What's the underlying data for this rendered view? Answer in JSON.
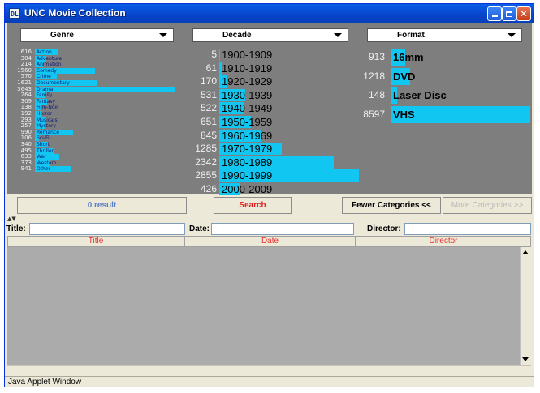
{
  "window": {
    "title": "UNC Movie Collection",
    "icon_text": "DL"
  },
  "genre": {
    "label": "Genre",
    "items": [
      {
        "count": "616",
        "label": "Action",
        "value": 616
      },
      {
        "count": "304",
        "label": "Adventure",
        "value": 304
      },
      {
        "count": "214",
        "label": "Animation",
        "value": 214
      },
      {
        "count": "1560",
        "label": "Comedy",
        "value": 1560
      },
      {
        "count": "570",
        "label": "Crime",
        "value": 570
      },
      {
        "count": "1621",
        "label": "Documentary",
        "value": 1621
      },
      {
        "count": "3643",
        "label": "Drama",
        "value": 3643
      },
      {
        "count": "264",
        "label": "Family",
        "value": 264
      },
      {
        "count": "309",
        "label": "Fantasy",
        "value": 309
      },
      {
        "count": "138",
        "label": "Film-Noir",
        "value": 138
      },
      {
        "count": "192",
        "label": "Horror",
        "value": 192
      },
      {
        "count": "293",
        "label": "Musicals",
        "value": 293
      },
      {
        "count": "257",
        "label": "Mystery",
        "value": 257
      },
      {
        "count": "990",
        "label": "Romance",
        "value": 990
      },
      {
        "count": "106",
        "label": "Sci-Fi",
        "value": 106
      },
      {
        "count": "340",
        "label": "Short",
        "value": 340
      },
      {
        "count": "495",
        "label": "Thriller",
        "value": 495
      },
      {
        "count": "633",
        "label": "War",
        "value": 633
      },
      {
        "count": "373",
        "label": "Western",
        "value": 373
      },
      {
        "count": "941",
        "label": "Other",
        "value": 941
      }
    ]
  },
  "decade": {
    "label": "Decade",
    "items": [
      {
        "count": "5",
        "label": "1900-1909",
        "value": 5
      },
      {
        "count": "61",
        "label": "1910-1919",
        "value": 61
      },
      {
        "count": "170",
        "label": "1920-1929",
        "value": 170
      },
      {
        "count": "531",
        "label": "1930-1939",
        "value": 531
      },
      {
        "count": "522",
        "label": "1940-1949",
        "value": 522
      },
      {
        "count": "651",
        "label": "1950-1959",
        "value": 651
      },
      {
        "count": "845",
        "label": "1960-1969",
        "value": 845
      },
      {
        "count": "1285",
        "label": "1970-1979",
        "value": 1285
      },
      {
        "count": "2342",
        "label": "1980-1989",
        "value": 2342
      },
      {
        "count": "2855",
        "label": "1990-1999",
        "value": 2855
      },
      {
        "count": "426",
        "label": "2000-2009",
        "value": 426
      }
    ]
  },
  "format": {
    "label": "Format",
    "items": [
      {
        "count": "913",
        "label": "16mm",
        "value": 913
      },
      {
        "count": "1218",
        "label": "DVD",
        "value": 1218
      },
      {
        "count": "148",
        "label": "Laser Disc",
        "value": 148
      },
      {
        "count": "8597",
        "label": "VHS",
        "value": 8597
      }
    ]
  },
  "buttons": {
    "result": "0 result",
    "search": "Search",
    "fewer": "Fewer Categories <<",
    "more": "More Categories >>"
  },
  "fields": {
    "title": "Title:",
    "date": "Date:",
    "director": "Director:"
  },
  "columns": [
    "Title",
    "Date",
    "Director"
  ],
  "status": "Java Applet Window",
  "colors": {
    "bar": "#11c7f2",
    "accent_text": "#e83030",
    "panel": "#7e7e7e"
  }
}
